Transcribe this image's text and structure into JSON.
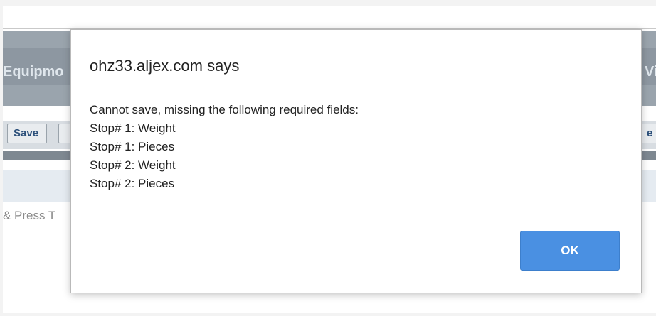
{
  "background": {
    "title_left": "Equipmo",
    "title_right": "Vie",
    "toolbar": {
      "save_label": "Save",
      "right_partial": "e"
    },
    "hint_text": "& Press T"
  },
  "dialog": {
    "title": "ohz33.aljex.com says",
    "message_lines": [
      "Cannot save, missing the following required fields:",
      "Stop# 1: Weight",
      "Stop# 1: Pieces",
      "Stop# 2: Weight",
      "Stop# 2: Pieces"
    ],
    "ok_label": "OK"
  },
  "colors": {
    "ok_button": "#4a90e2",
    "header_band": "#9aa4ad"
  }
}
